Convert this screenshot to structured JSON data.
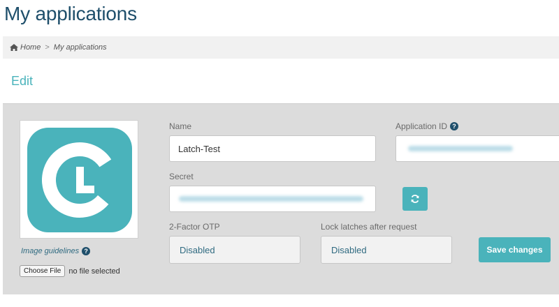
{
  "page": {
    "title": "My applications"
  },
  "breadcrumb": {
    "home": "Home",
    "separator": ">",
    "current": "My applications"
  },
  "section": {
    "title": "Edit"
  },
  "logo": {
    "letters": "CL",
    "color": "#4ab3bb"
  },
  "image_guidelines": {
    "label": "Image guidelines",
    "help_icon": "?"
  },
  "file_input": {
    "button_label": "Choose File",
    "status": "no file selected"
  },
  "form": {
    "name_label": "Name",
    "name_value": "Latch-Test",
    "appid_label": "Application ID",
    "appid_help_icon": "?",
    "secret_label": "Secret",
    "otp_label": "2-Factor OTP",
    "otp_value": "Disabled",
    "lock_label": "Lock latches after request",
    "lock_value": "Disabled",
    "save_label": "Save changes"
  },
  "colors": {
    "accent": "#4ab3bb",
    "title": "#1f4f6b",
    "panel": "#dcdcdc"
  },
  "icons": {
    "home": "home-icon",
    "refresh": "refresh-icon",
    "help": "help-icon"
  }
}
